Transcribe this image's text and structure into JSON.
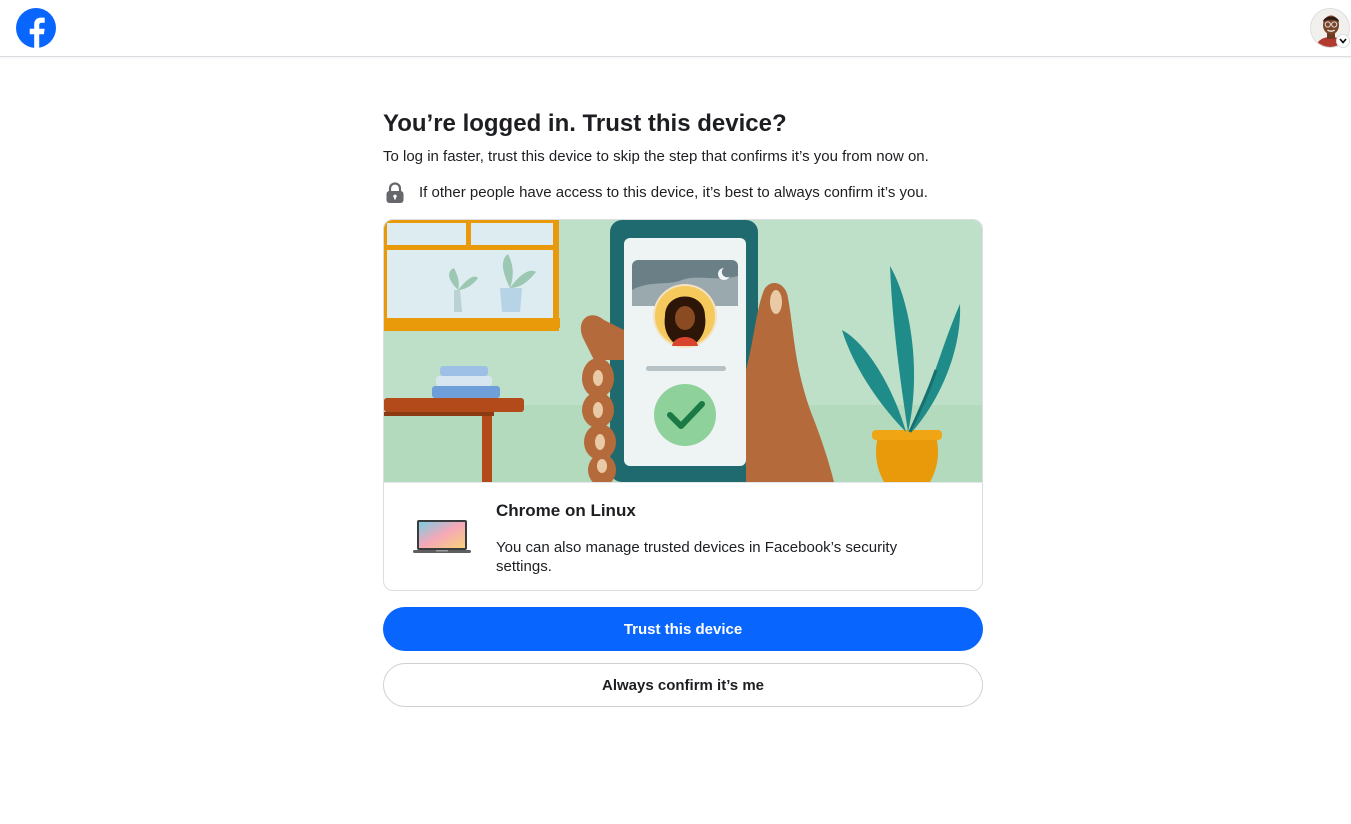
{
  "header": {
    "logo_icon": "facebook-logo-icon",
    "avatar_icon": "profile-avatar",
    "menu_icon": "chevron-down-icon"
  },
  "main": {
    "title": "You’re logged in. Trust this device?",
    "subtitle": "To log in faster, trust this device to skip the step that confirms it’s you from now on.",
    "notice_icon": "lock-icon",
    "notice": "If other people have access to this device, it’s best to always confirm it’s you."
  },
  "device": {
    "icon": "laptop-icon",
    "name": "Chrome on Linux",
    "description": "You can also manage trusted devices in Facebook’s security settings."
  },
  "actions": {
    "trust_label": "Trust this device",
    "confirm_label": "Always confirm it’s me"
  },
  "colors": {
    "brand": "#0866ff",
    "illustration_bg": "#bfe0c8",
    "text": "#1c1e21",
    "border": "#dadde1"
  }
}
